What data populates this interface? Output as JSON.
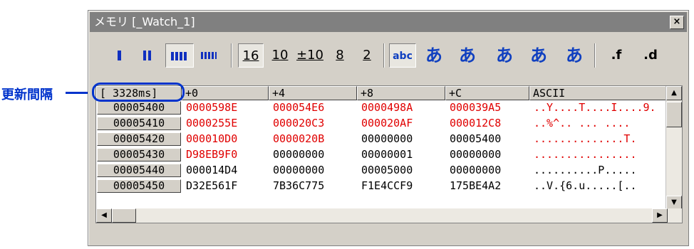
{
  "callout": {
    "label": "更新間隔"
  },
  "window": {
    "title": "メモリ [_Watch_1]",
    "close_glyph": "×"
  },
  "toolbar": {
    "radix_buttons": [
      "16",
      "10",
      "±10",
      "8",
      "2"
    ],
    "ascii_button": "abc",
    "kana_buttons": [
      "あ",
      "あ",
      "あ",
      "あ",
      "あ"
    ],
    "float_buttons": [
      ".f",
      ".d"
    ]
  },
  "grid": {
    "refresh_interval": "[  3328ms]",
    "headers": [
      "+0",
      "+4",
      "+8",
      "+C",
      "ASCII"
    ],
    "rows": [
      {
        "addr": "00005400",
        "cells": [
          "0000598E",
          "000054E6",
          "0000498A",
          "000039A5"
        ],
        "red": [
          true,
          true,
          true,
          true
        ],
        "ascii": "..Y....T....I....9."
      },
      {
        "addr": "00005410",
        "cells": [
          "0000255E",
          "000020C3",
          "000020AF",
          "000012C8"
        ],
        "red": [
          true,
          true,
          true,
          true
        ],
        "ascii": "..%^.. ... ...."
      },
      {
        "addr": "00005420",
        "cells": [
          "000010D0",
          "0000020B",
          "00000000",
          "00005400"
        ],
        "red": [
          true,
          true,
          false,
          false
        ],
        "ascii": "..............T."
      },
      {
        "addr": "00005430",
        "cells": [
          "D98EB9F0",
          "00000000",
          "00000001",
          "00000000"
        ],
        "red": [
          true,
          false,
          false,
          false
        ],
        "ascii": "................"
      },
      {
        "addr": "00005440",
        "cells": [
          "000014D4",
          "00000000",
          "00005000",
          "00000000"
        ],
        "red": [
          false,
          false,
          false,
          false
        ],
        "ascii": "..........P....."
      },
      {
        "addr": "00005450",
        "cells": [
          "D32E561F",
          "7B36C775",
          "F1E4CCF9",
          "175BE4A2"
        ],
        "red": [
          false,
          false,
          false,
          false
        ],
        "ascii": "..V.{6.u.....[.."
      }
    ]
  },
  "colors": {
    "accent": "#0033cc",
    "changed_value": "#e00000",
    "face": "#d4d0c8"
  }
}
